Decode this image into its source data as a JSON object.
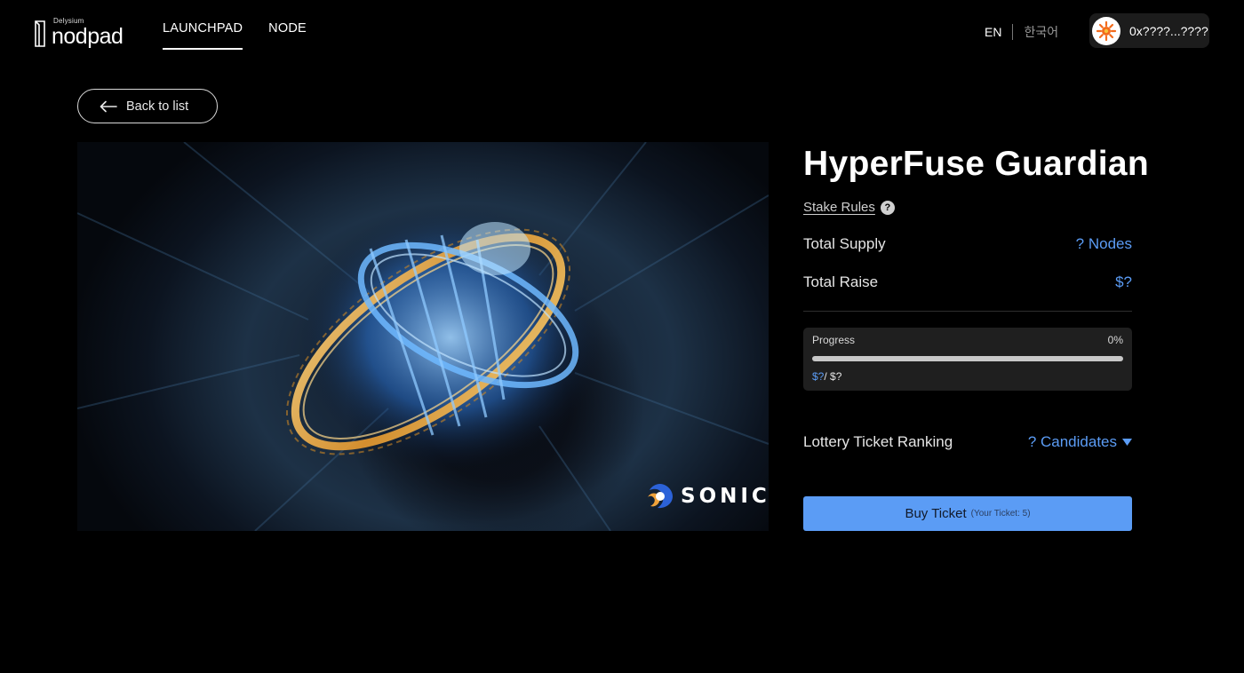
{
  "header": {
    "logo_small": "Delysium",
    "logo_main": "nodpad",
    "nav": [
      {
        "label": "LAUNCHPAD",
        "active": true
      },
      {
        "label": "NODE",
        "active": false
      }
    ],
    "lang_en": "EN",
    "lang_ko": "한국어",
    "wallet_address": "0x????...????"
  },
  "back_button": {
    "label": "Back to list"
  },
  "hero": {
    "brand": "SONIC"
  },
  "project": {
    "title": "HyperFuse Guardian",
    "stake_rules": "Stake Rules",
    "help_glyph": "?",
    "total_supply_label": "Total Supply",
    "total_supply_value": "? Nodes",
    "total_raise_label": "Total Raise",
    "total_raise_value": "$?",
    "progress": {
      "label": "Progress",
      "percent_text": "0%",
      "fill_fraction": 0,
      "current": "$?",
      "total": "/ $?"
    },
    "lottery_label": "Lottery Ticket Ranking",
    "lottery_value": "? Candidates",
    "buy_label": "Buy Ticket",
    "buy_sub": "(Your Ticket: 5)"
  },
  "colors": {
    "accent": "#5b9cf5",
    "background": "#000000"
  }
}
